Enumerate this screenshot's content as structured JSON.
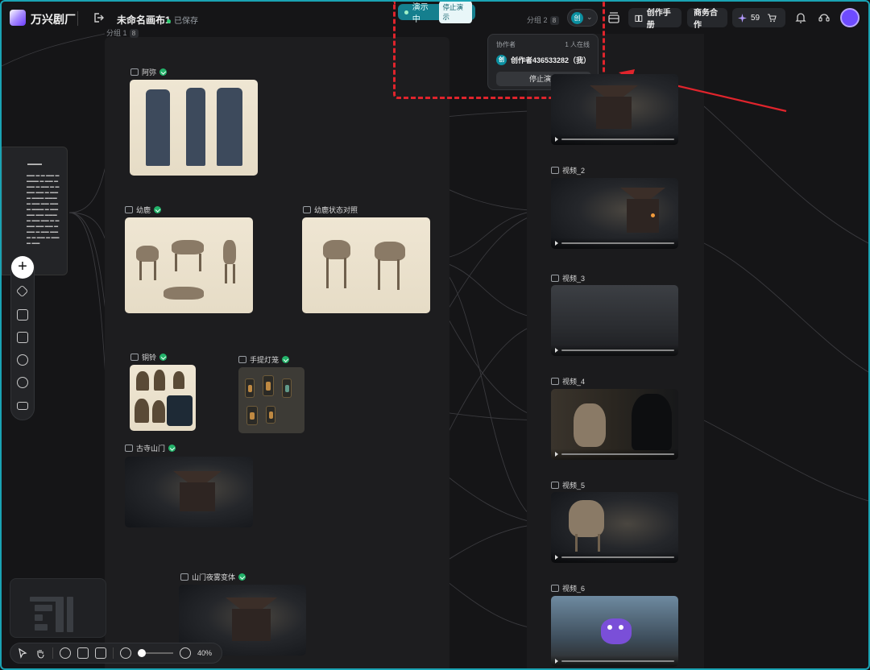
{
  "header": {
    "brand": "万兴剧厂",
    "canvas_name": "未命名画布1",
    "saved_status": "已保存",
    "group2_label": "分组 2",
    "group2_count": "8",
    "collab_avatar_letter": "创",
    "manual_label": "创作手册",
    "business_label": "商务合作",
    "credits": "59"
  },
  "presentation": {
    "status": "演示中",
    "stop_label": "停止演示"
  },
  "collab_panel": {
    "title": "协作者",
    "online": "1 人在线",
    "user": "创作者436533282（我）",
    "stop_button": "停止演示"
  },
  "group1": {
    "label": "分组 1",
    "count": "8"
  },
  "nodes": [
    {
      "title": "阿弥"
    },
    {
      "title": "幼鹿"
    },
    {
      "title": "幼鹿状态对照"
    },
    {
      "title": "铜铃"
    },
    {
      "title": "手提灯笼"
    },
    {
      "title": "古寺山门"
    },
    {
      "title": "山门夜雾变体"
    }
  ],
  "videos": [
    {
      "title": "视频_2"
    },
    {
      "title": "视频_3"
    },
    {
      "title": "视频_4"
    },
    {
      "title": "视频_5"
    },
    {
      "title": "视频_6"
    }
  ],
  "zoom": "40%",
  "colors": {
    "accent": "#1aa3b3",
    "highlight": "#e0242c",
    "success": "#23b36a",
    "purple": "#6e4bff"
  }
}
